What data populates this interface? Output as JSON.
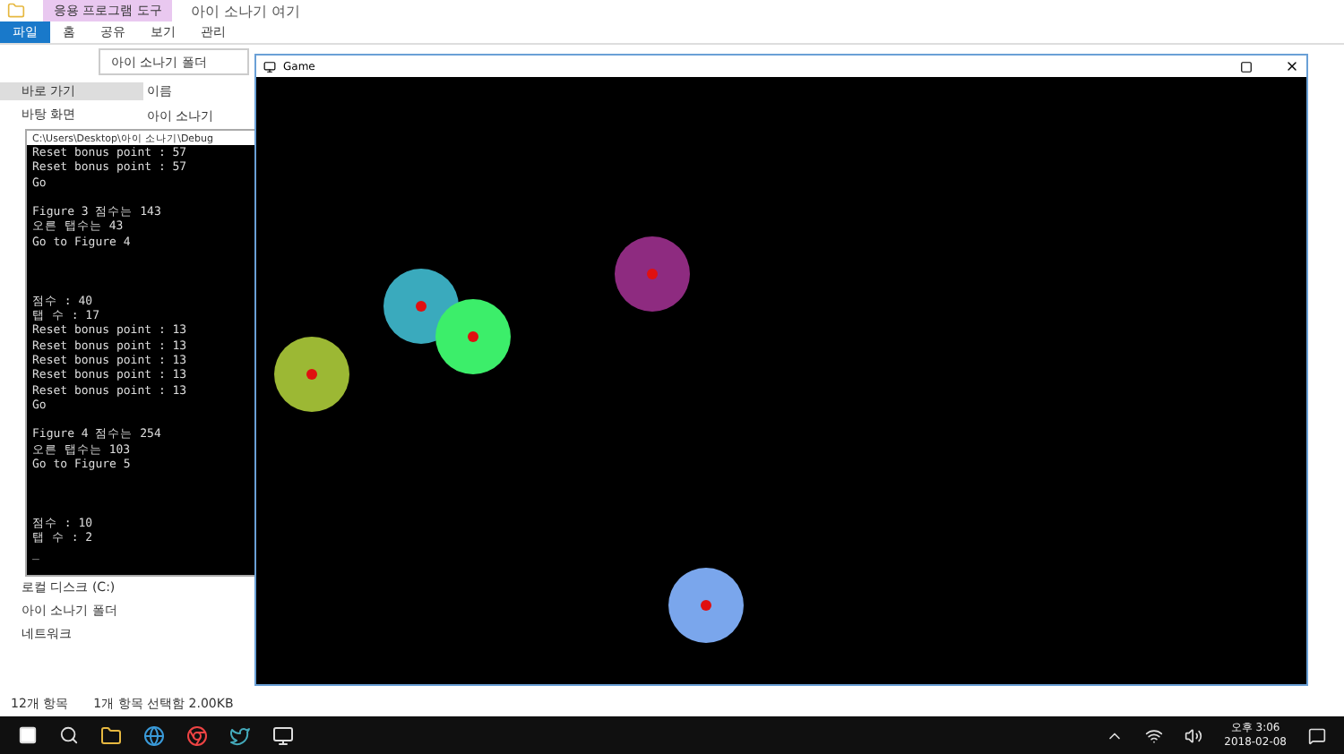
{
  "explorer": {
    "context_tab": "응용 프로그램 도구",
    "title": "아이 소나기 여기",
    "ribbon_tabs": [
      {
        "label": "파일",
        "selected": true
      },
      {
        "label": "홈",
        "selected": false
      },
      {
        "label": "공유",
        "selected": false
      },
      {
        "label": "보기",
        "selected": false
      },
      {
        "label": "관리",
        "selected": false
      }
    ],
    "address": "아이 소나기 폴더",
    "nav_items": [
      {
        "label": "바로 가기",
        "selected": true
      },
      {
        "label": "바탕 화면",
        "selected": false
      },
      {
        "label": "로컬 디스크 (C:)",
        "selected": false
      },
      {
        "label": "아이 소나기 폴더",
        "selected": false
      },
      {
        "label": "네트워크",
        "selected": false
      }
    ],
    "column_header": "이름",
    "file_item": "아이 소나기",
    "status_count": "12개 항목",
    "status_selection": "1개 항목 선택함 2.00KB"
  },
  "console": {
    "title": "C:\\Users\\Desktop\\아이 소나기\\Debug",
    "blocks": [
      [
        "Reset bonus point : 57",
        "Reset bonus point : 57",
        "Go"
      ],
      [
        "Figure 3 점수는 143",
        "오른 탭수는 43",
        "Go to Figure 4"
      ],
      [
        "점수 : 40",
        "탭 수 : 17",
        "Reset bonus point : 13",
        "Reset bonus point : 13",
        "Reset bonus point : 13",
        "Reset bonus point : 13",
        "Reset bonus point : 13",
        "Go"
      ],
      [
        "Figure 4 점수는 254",
        "오른 탭수는 103",
        "Go to Figure 5"
      ],
      [
        "점수 : 10",
        "탭 수 : 2",
        "_"
      ]
    ]
  },
  "game": {
    "title": "Game",
    "circles": [
      {
        "color": "#3aaabd"
      },
      {
        "color": "#3cee6a"
      },
      {
        "color": "#9cb834"
      },
      {
        "color": "#8e2b80"
      },
      {
        "color": "#7aa6ec"
      }
    ]
  },
  "taskbar": {
    "time": "오후 3:06",
    "date": "2018-02-08"
  }
}
